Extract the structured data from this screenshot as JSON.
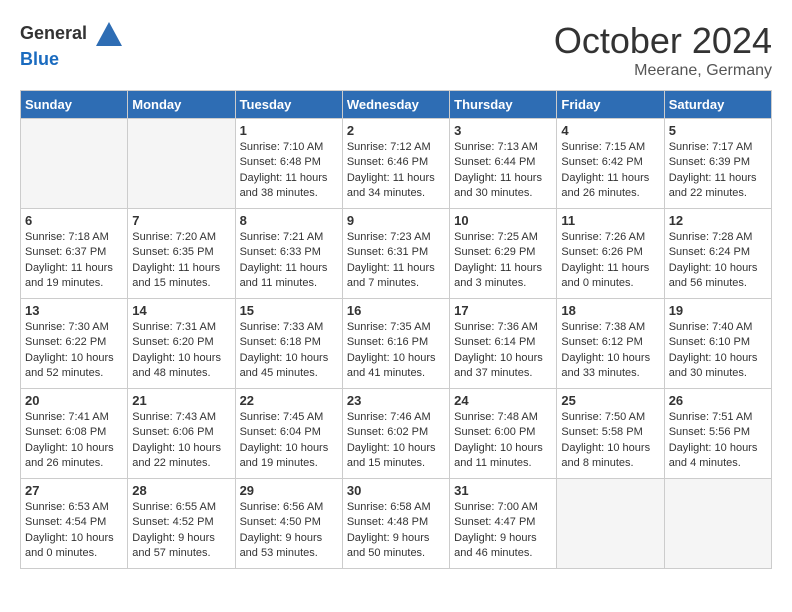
{
  "header": {
    "logo_general": "General",
    "logo_blue": "Blue",
    "title": "October 2024",
    "location": "Meerane, Germany"
  },
  "days_of_week": [
    "Sunday",
    "Monday",
    "Tuesday",
    "Wednesday",
    "Thursday",
    "Friday",
    "Saturday"
  ],
  "weeks": [
    [
      {
        "day": "",
        "empty": true
      },
      {
        "day": "",
        "empty": true
      },
      {
        "day": "1",
        "sunrise": "Sunrise: 7:10 AM",
        "sunset": "Sunset: 6:48 PM",
        "daylight": "Daylight: 11 hours and 38 minutes."
      },
      {
        "day": "2",
        "sunrise": "Sunrise: 7:12 AM",
        "sunset": "Sunset: 6:46 PM",
        "daylight": "Daylight: 11 hours and 34 minutes."
      },
      {
        "day": "3",
        "sunrise": "Sunrise: 7:13 AM",
        "sunset": "Sunset: 6:44 PM",
        "daylight": "Daylight: 11 hours and 30 minutes."
      },
      {
        "day": "4",
        "sunrise": "Sunrise: 7:15 AM",
        "sunset": "Sunset: 6:42 PM",
        "daylight": "Daylight: 11 hours and 26 minutes."
      },
      {
        "day": "5",
        "sunrise": "Sunrise: 7:17 AM",
        "sunset": "Sunset: 6:39 PM",
        "daylight": "Daylight: 11 hours and 22 minutes."
      }
    ],
    [
      {
        "day": "6",
        "sunrise": "Sunrise: 7:18 AM",
        "sunset": "Sunset: 6:37 PM",
        "daylight": "Daylight: 11 hours and 19 minutes."
      },
      {
        "day": "7",
        "sunrise": "Sunrise: 7:20 AM",
        "sunset": "Sunset: 6:35 PM",
        "daylight": "Daylight: 11 hours and 15 minutes."
      },
      {
        "day": "8",
        "sunrise": "Sunrise: 7:21 AM",
        "sunset": "Sunset: 6:33 PM",
        "daylight": "Daylight: 11 hours and 11 minutes."
      },
      {
        "day": "9",
        "sunrise": "Sunrise: 7:23 AM",
        "sunset": "Sunset: 6:31 PM",
        "daylight": "Daylight: 11 hours and 7 minutes."
      },
      {
        "day": "10",
        "sunrise": "Sunrise: 7:25 AM",
        "sunset": "Sunset: 6:29 PM",
        "daylight": "Daylight: 11 hours and 3 minutes."
      },
      {
        "day": "11",
        "sunrise": "Sunrise: 7:26 AM",
        "sunset": "Sunset: 6:26 PM",
        "daylight": "Daylight: 11 hours and 0 minutes."
      },
      {
        "day": "12",
        "sunrise": "Sunrise: 7:28 AM",
        "sunset": "Sunset: 6:24 PM",
        "daylight": "Daylight: 10 hours and 56 minutes."
      }
    ],
    [
      {
        "day": "13",
        "sunrise": "Sunrise: 7:30 AM",
        "sunset": "Sunset: 6:22 PM",
        "daylight": "Daylight: 10 hours and 52 minutes."
      },
      {
        "day": "14",
        "sunrise": "Sunrise: 7:31 AM",
        "sunset": "Sunset: 6:20 PM",
        "daylight": "Daylight: 10 hours and 48 minutes."
      },
      {
        "day": "15",
        "sunrise": "Sunrise: 7:33 AM",
        "sunset": "Sunset: 6:18 PM",
        "daylight": "Daylight: 10 hours and 45 minutes."
      },
      {
        "day": "16",
        "sunrise": "Sunrise: 7:35 AM",
        "sunset": "Sunset: 6:16 PM",
        "daylight": "Daylight: 10 hours and 41 minutes."
      },
      {
        "day": "17",
        "sunrise": "Sunrise: 7:36 AM",
        "sunset": "Sunset: 6:14 PM",
        "daylight": "Daylight: 10 hours and 37 minutes."
      },
      {
        "day": "18",
        "sunrise": "Sunrise: 7:38 AM",
        "sunset": "Sunset: 6:12 PM",
        "daylight": "Daylight: 10 hours and 33 minutes."
      },
      {
        "day": "19",
        "sunrise": "Sunrise: 7:40 AM",
        "sunset": "Sunset: 6:10 PM",
        "daylight": "Daylight: 10 hours and 30 minutes."
      }
    ],
    [
      {
        "day": "20",
        "sunrise": "Sunrise: 7:41 AM",
        "sunset": "Sunset: 6:08 PM",
        "daylight": "Daylight: 10 hours and 26 minutes."
      },
      {
        "day": "21",
        "sunrise": "Sunrise: 7:43 AM",
        "sunset": "Sunset: 6:06 PM",
        "daylight": "Daylight: 10 hours and 22 minutes."
      },
      {
        "day": "22",
        "sunrise": "Sunrise: 7:45 AM",
        "sunset": "Sunset: 6:04 PM",
        "daylight": "Daylight: 10 hours and 19 minutes."
      },
      {
        "day": "23",
        "sunrise": "Sunrise: 7:46 AM",
        "sunset": "Sunset: 6:02 PM",
        "daylight": "Daylight: 10 hours and 15 minutes."
      },
      {
        "day": "24",
        "sunrise": "Sunrise: 7:48 AM",
        "sunset": "Sunset: 6:00 PM",
        "daylight": "Daylight: 10 hours and 11 minutes."
      },
      {
        "day": "25",
        "sunrise": "Sunrise: 7:50 AM",
        "sunset": "Sunset: 5:58 PM",
        "daylight": "Daylight: 10 hours and 8 minutes."
      },
      {
        "day": "26",
        "sunrise": "Sunrise: 7:51 AM",
        "sunset": "Sunset: 5:56 PM",
        "daylight": "Daylight: 10 hours and 4 minutes."
      }
    ],
    [
      {
        "day": "27",
        "sunrise": "Sunrise: 6:53 AM",
        "sunset": "Sunset: 4:54 PM",
        "daylight": "Daylight: 10 hours and 0 minutes."
      },
      {
        "day": "28",
        "sunrise": "Sunrise: 6:55 AM",
        "sunset": "Sunset: 4:52 PM",
        "daylight": "Daylight: 9 hours and 57 minutes."
      },
      {
        "day": "29",
        "sunrise": "Sunrise: 6:56 AM",
        "sunset": "Sunset: 4:50 PM",
        "daylight": "Daylight: 9 hours and 53 minutes."
      },
      {
        "day": "30",
        "sunrise": "Sunrise: 6:58 AM",
        "sunset": "Sunset: 4:48 PM",
        "daylight": "Daylight: 9 hours and 50 minutes."
      },
      {
        "day": "31",
        "sunrise": "Sunrise: 7:00 AM",
        "sunset": "Sunset: 4:47 PM",
        "daylight": "Daylight: 9 hours and 46 minutes."
      },
      {
        "day": "",
        "empty": true
      },
      {
        "day": "",
        "empty": true
      }
    ]
  ]
}
